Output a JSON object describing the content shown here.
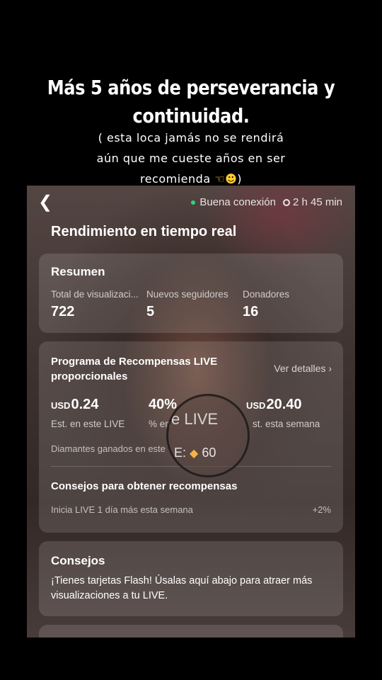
{
  "caption": {
    "title": "Más 5 años de perseverancia y continuidad.",
    "subtitle_line1": "( esta loca jamás no se rendirá",
    "subtitle_line2": "aún que me cueste años en ser",
    "subtitle_line3": "recomienda",
    "subtitle_end": ")",
    "emojis": [
      "backhand-index-pointing-left",
      "smiling-face-with-sunglasses"
    ]
  },
  "topbar": {
    "back_icon": "chevron-left-icon",
    "connection": "Buena conexión",
    "duration": "2 h 45 min"
  },
  "screen_title": "Rendimiento en tiempo real",
  "summary": {
    "heading": "Resumen",
    "stats": [
      {
        "label": "Total de visualizaci...",
        "value": "722"
      },
      {
        "label": "Nuevos seguidores",
        "value": "5"
      },
      {
        "label": "Donadores",
        "value": "16"
      }
    ]
  },
  "rewards": {
    "title": "Programa de Recompensas LIVE proporcionales",
    "details_link": "Ver detalles",
    "currency": "USD",
    "est_live_value": "0.24",
    "est_live_label": "Est. en este LIVE",
    "percent_value": "40%",
    "percent_label": "% en",
    "week_value": "20.40",
    "week_label": "st. esta semana",
    "diamonds_label": "Diamantes ganados en este",
    "magnifier_live": "e LIVE",
    "magnifier_gem": "E:",
    "magnifier_count": "60",
    "tips_heading": "Consejos para obtener recompensas",
    "tip_text": "Inicia LIVE 1 día más esta semana",
    "tip_bonus": "+2%"
  },
  "advice": {
    "heading": "Consejos",
    "text": "¡Tienes tarjetas Flash! Úsalas aquí abajo para atraer más visualizaciones a tu LIVE."
  }
}
